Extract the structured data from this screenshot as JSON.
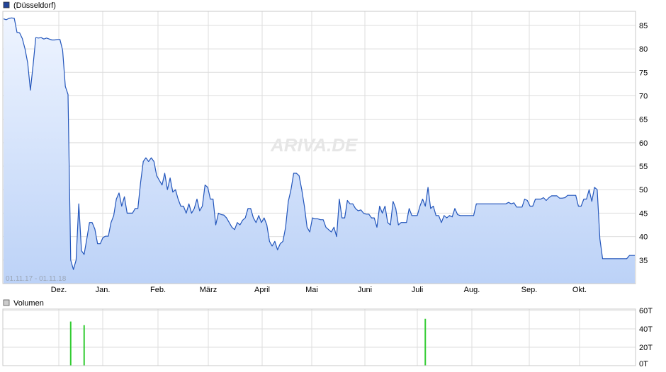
{
  "legend_price": "(Düsseldorf)",
  "legend_volume": "Volumen",
  "date_range": "01.11.17 - 01.11.18",
  "watermark": "ARIVA.DE",
  "colors": {
    "price_line": "#2255bb",
    "fill_top": "#eef4ff",
    "fill_bottom": "#bcd2f7",
    "volume_bar": "#33cc33",
    "grid": "#dddddd",
    "legend_price_box": "#224499",
    "legend_volume_box": "#cccccc"
  },
  "chart_data": [
    {
      "type": "area",
      "x_tick_labels": [
        "Dez.",
        "Jan.",
        "Feb.",
        "März",
        "April",
        "Mai",
        "Juni",
        "Juli",
        "Aug.",
        "Sep.",
        "Okt."
      ],
      "y_tick_labels": [
        "35",
        "40",
        "45",
        "50",
        "55",
        "60",
        "65",
        "70",
        "75",
        "80",
        "85"
      ],
      "ylim": [
        30,
        88
      ],
      "grid": true,
      "values": [
        86.4,
        86.2,
        86.5,
        86.6,
        86.5,
        83.5,
        83.4,
        82.2,
        80,
        77,
        71.2,
        76.5,
        82.4,
        82.3,
        82.4,
        82.1,
        82.3,
        82.1,
        81.9,
        81.9,
        82,
        82,
        79.7,
        72,
        70.3,
        35,
        33,
        35,
        47,
        37,
        36.2,
        39.5,
        43,
        43,
        41.6,
        38.5,
        38.5,
        39.8,
        40.1,
        40.1,
        43,
        44.5,
        48,
        49.3,
        46.5,
        48.5,
        45,
        45,
        45,
        46,
        46,
        51.5,
        56,
        56.8,
        56,
        56.8,
        56,
        53,
        52,
        51,
        53.5,
        50,
        52.5,
        49.5,
        50,
        48,
        46.5,
        46.5,
        45,
        47,
        45,
        46,
        48,
        45.5,
        46.5,
        51,
        50.5,
        48,
        48,
        42.5,
        45,
        44.7,
        44.6,
        44,
        43,
        42,
        41.5,
        43,
        42.5,
        43.5,
        44,
        46,
        46,
        44,
        43,
        44.5,
        43,
        44,
        42.5,
        39,
        38,
        39,
        37.2,
        38.5,
        39,
        42,
        47.5,
        50,
        53.5,
        53.5,
        53,
        50,
        46.5,
        42,
        41,
        44,
        43.8,
        43.8,
        43.6,
        43.6,
        42,
        41.5,
        41,
        42,
        40,
        48,
        44,
        44,
        47.7,
        47,
        47,
        46,
        45.5,
        45.7,
        45,
        44.8,
        44.8,
        44,
        44,
        42,
        46.5,
        45,
        46.5,
        43,
        42.5,
        47.5,
        46,
        42.5,
        43,
        43,
        43,
        46,
        44.5,
        44.5,
        44.5,
        46.5,
        48,
        46.5,
        50.5,
        46,
        46.5,
        44.5,
        44.5,
        43,
        44.5,
        44,
        44.5,
        44.2,
        46,
        44.7,
        44.5,
        44.5,
        44.5,
        44.5,
        44.5,
        44.5,
        47,
        47,
        47,
        47,
        47,
        47,
        47,
        47,
        47,
        47,
        47,
        47,
        47.3,
        47,
        47.2,
        46.3,
        46.3,
        46.3,
        48,
        47.7,
        46.5,
        46.5,
        48,
        48,
        48,
        48.3,
        47.7,
        48.3,
        48.7,
        48.7,
        48.7,
        48.2,
        48.2,
        48.3,
        48.8,
        48.8,
        48.8,
        48.8,
        46.5,
        46.5,
        48,
        48,
        50,
        47.5,
        50.5,
        50,
        39.5,
        35.3,
        35.3,
        35.3,
        35.3,
        35.3,
        35.3,
        35.3,
        35.3,
        35.3,
        35.3,
        36,
        36,
        36
      ]
    },
    {
      "type": "bar",
      "title": "Volumen",
      "y_tick_labels": [
        "0T",
        "20T",
        "40T",
        "60T"
      ],
      "ylim": [
        0,
        60
      ],
      "grid": true,
      "bars": [
        {
          "index": 25,
          "value": 48
        },
        {
          "index": 30,
          "value": 44
        },
        {
          "index": 157,
          "value": 51
        }
      ]
    }
  ]
}
